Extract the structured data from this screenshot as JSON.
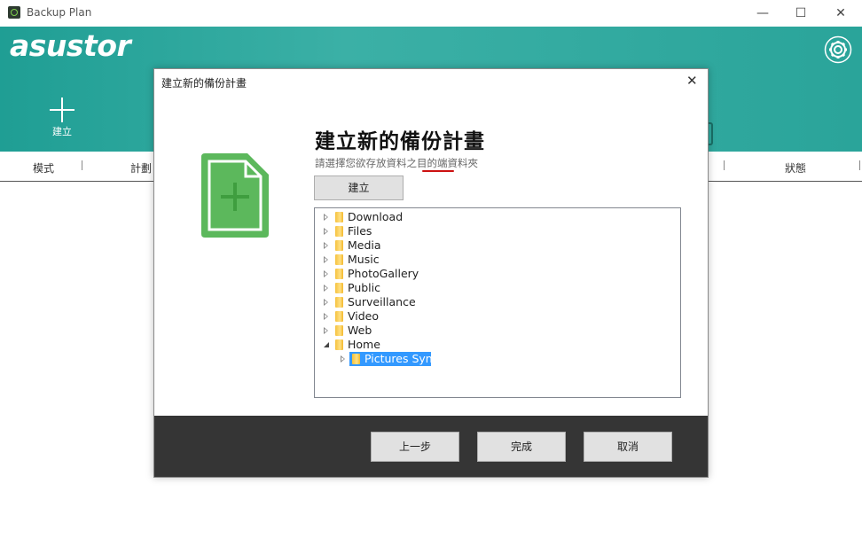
{
  "window": {
    "title": "Backup Plan",
    "minimize": "—",
    "maximize": "☐",
    "close": "✕"
  },
  "header": {
    "logo": "asustor",
    "add_label": "建立"
  },
  "columns": {
    "mode": "模式",
    "plan": "計劃",
    "status": "狀態"
  },
  "dialog": {
    "title": "建立新的備份計畫",
    "close": "✕",
    "heading": "建立新的備份計畫",
    "subtitle": "請選擇您欲存放資料之目的端資料夾",
    "create_button": "建立",
    "tree": [
      {
        "label": "Download",
        "expanded": false
      },
      {
        "label": "Files",
        "expanded": false
      },
      {
        "label": "Media",
        "expanded": false
      },
      {
        "label": "Music",
        "expanded": false
      },
      {
        "label": "PhotoGallery",
        "expanded": false
      },
      {
        "label": "Public",
        "expanded": false
      },
      {
        "label": "Surveillance",
        "expanded": false
      },
      {
        "label": "Video",
        "expanded": false
      },
      {
        "label": "Web",
        "expanded": false
      },
      {
        "label": "Home",
        "expanded": true
      },
      {
        "label": "Pictures Sync",
        "expanded": false,
        "selected": true
      }
    ],
    "footer": {
      "back": "上一步",
      "finish": "完成",
      "cancel": "取消"
    }
  },
  "colors": {
    "header_teal": "#2aa49a",
    "selection": "#3399ff",
    "doc_icon_green": "#5cb85c",
    "footer_bg": "#353535"
  }
}
